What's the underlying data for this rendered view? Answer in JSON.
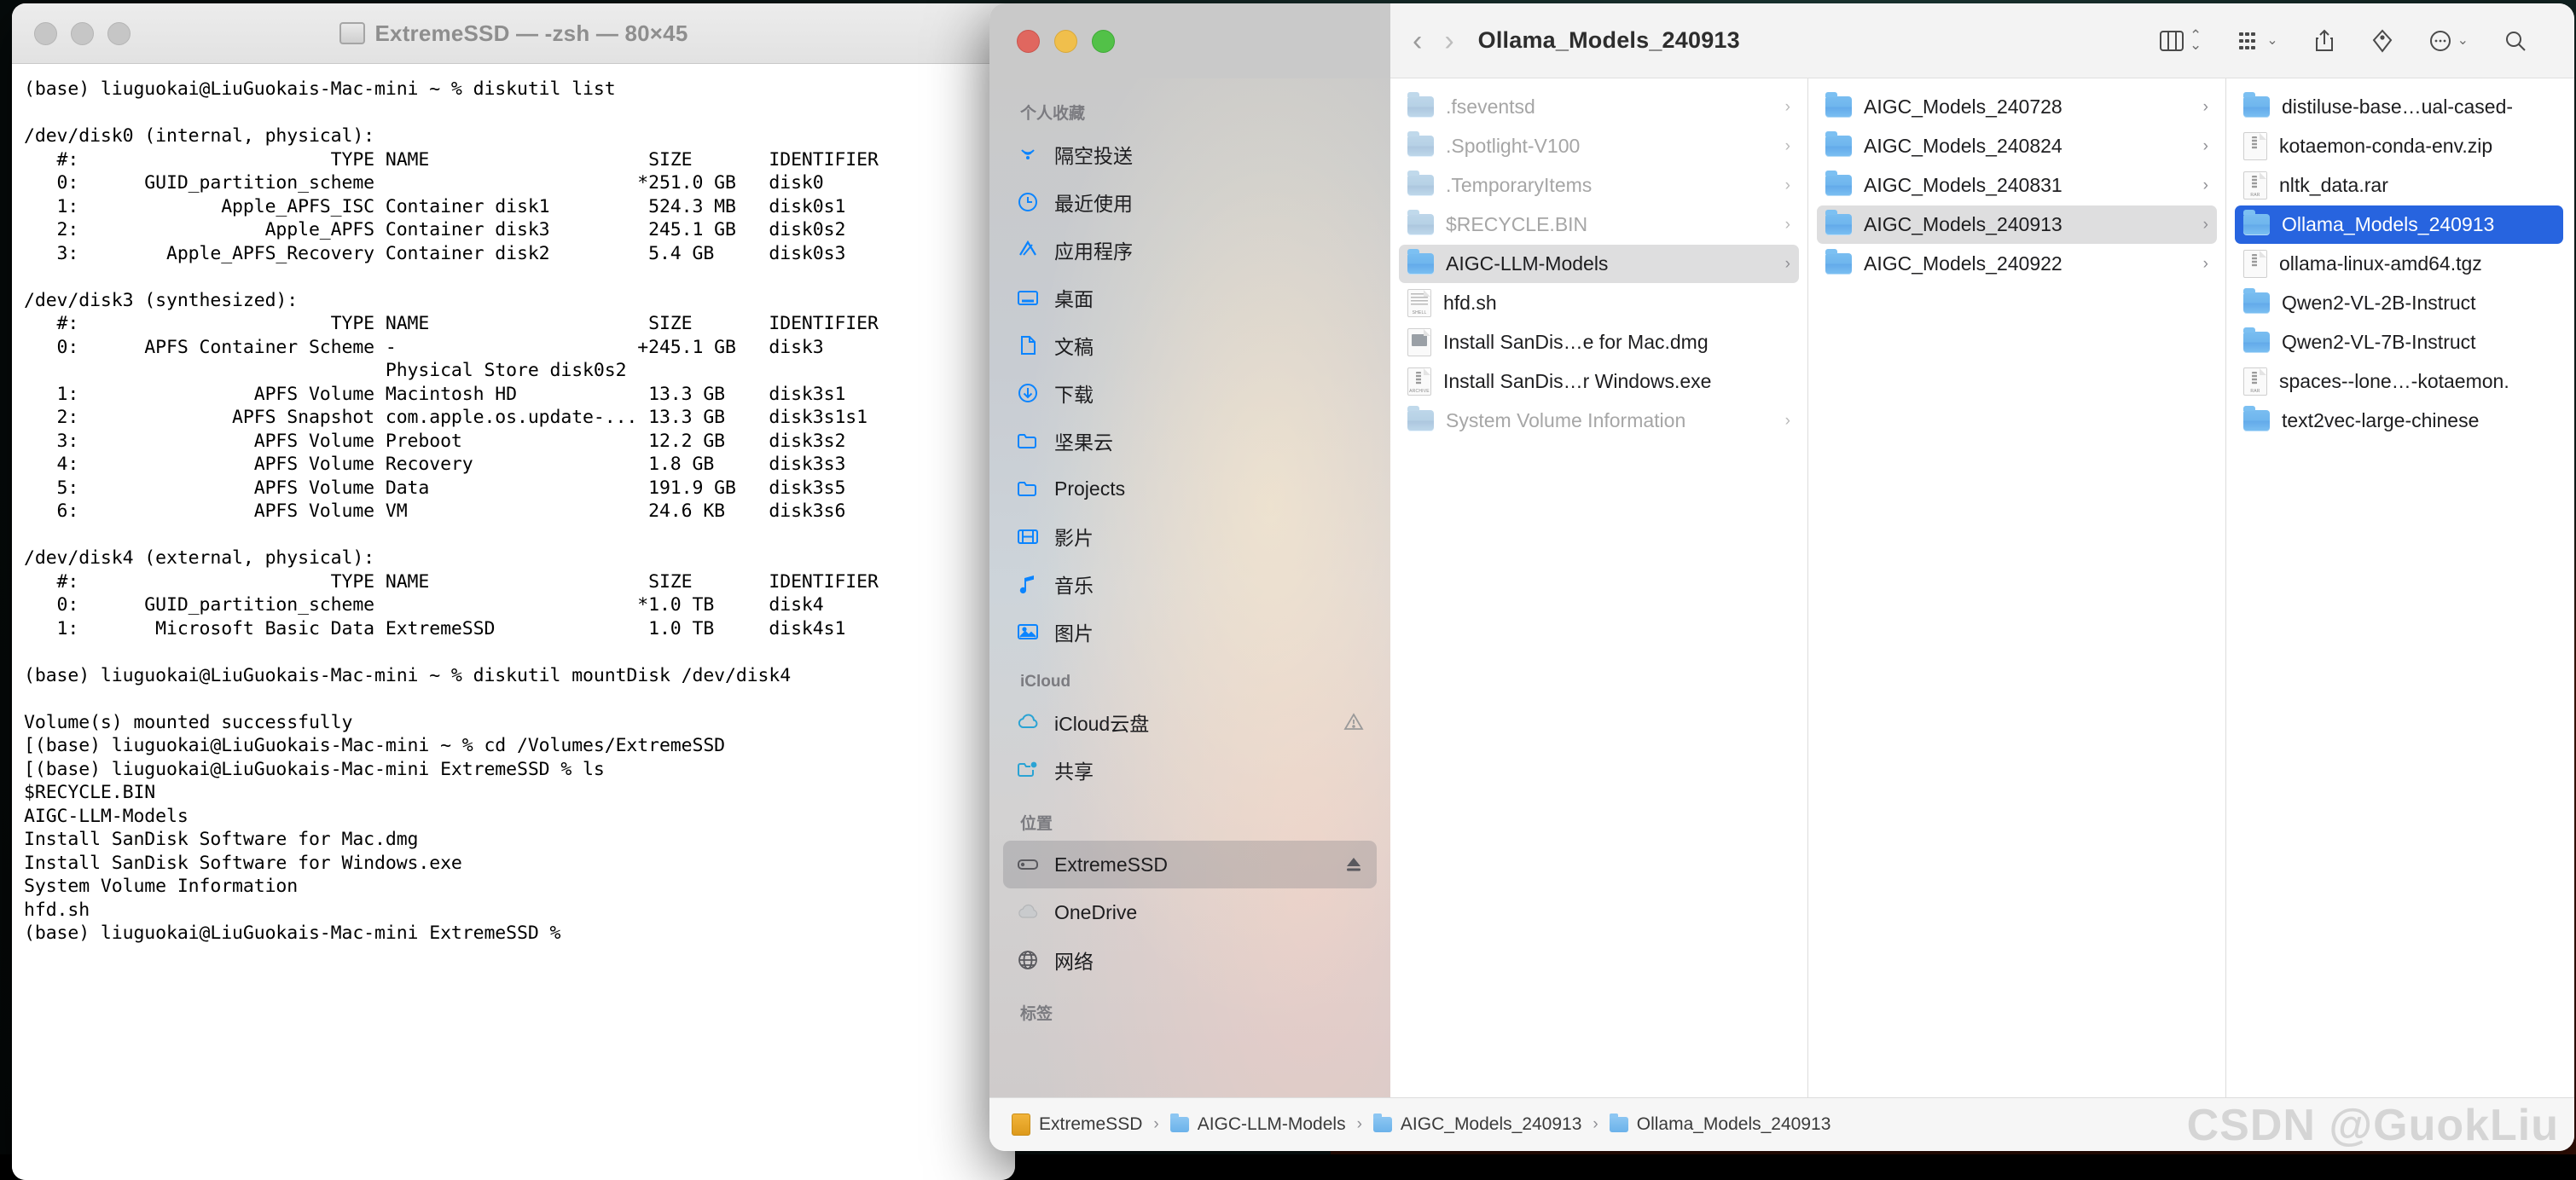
{
  "desktop": {
    "background_colors": [
      "#142826",
      "#2a1208"
    ]
  },
  "terminal": {
    "title": "ExtremeSSD — -zsh — 80×45",
    "title_icon": "disk-icon",
    "traffic_lights": [
      "close",
      "minimize",
      "zoom"
    ],
    "content": "(base) liuguokai@LiuGuokais-Mac-mini ~ % diskutil list\n\n/dev/disk0 (internal, physical):\n   #:                       TYPE NAME                    SIZE       IDENTIFIER\n   0:      GUID_partition_scheme                        *251.0 GB   disk0\n   1:             Apple_APFS_ISC Container disk1         524.3 MB   disk0s1\n   2:                 Apple_APFS Container disk3         245.1 GB   disk0s2\n   3:        Apple_APFS_Recovery Container disk2         5.4 GB     disk0s3\n\n/dev/disk3 (synthesized):\n   #:                       TYPE NAME                    SIZE       IDENTIFIER\n   0:      APFS Container Scheme -                      +245.1 GB   disk3\n                                 Physical Store disk0s2\n   1:                APFS Volume Macintosh HD            13.3 GB    disk3s1\n   2:              APFS Snapshot com.apple.os.update-... 13.3 GB    disk3s1s1\n   3:                APFS Volume Preboot                 12.2 GB    disk3s2\n   4:                APFS Volume Recovery                1.8 GB     disk3s3\n   5:                APFS Volume Data                    191.9 GB   disk3s5\n   6:                APFS Volume VM                      24.6 KB    disk3s6\n\n/dev/disk4 (external, physical):\n   #:                       TYPE NAME                    SIZE       IDENTIFIER\n   0:      GUID_partition_scheme                        *1.0 TB     disk4\n   1:       Microsoft Basic Data ExtremeSSD              1.0 TB     disk4s1\n\n(base) liuguokai@LiuGuokais-Mac-mini ~ % diskutil mountDisk /dev/disk4\n\nVolume(s) mounted successfully\n[(base) liuguokai@LiuGuokais-Mac-mini ~ % cd /Volumes/ExtremeSSD\n[(base) liuguokai@LiuGuokais-Mac-mini ExtremeSSD % ls\n$RECYCLE.BIN\nAIGC-LLM-Models\nInstall SanDisk Software for Mac.dmg\nInstall SanDisk Software for Windows.exe\nSystem Volume Information\nhfd.sh\n(base) liuguokai@LiuGuokais-Mac-mini ExtremeSSD % "
  },
  "finder": {
    "title": "Ollama_Models_240913",
    "traffic_lights": [
      "close",
      "minimize",
      "zoom"
    ],
    "toolbar": {
      "back_label": "‹",
      "forward_label": "›",
      "view_icon": "column-view-icon",
      "view_caret": "⌃⌄",
      "group_icon": "group-by-icon",
      "group_caret": "⌄",
      "share_icon": "share-icon",
      "tag_icon": "tag-icon",
      "more_icon": "more-actions-icon",
      "more_caret": "⌄",
      "search_icon": "search-icon"
    },
    "sidebar": {
      "sections": [
        {
          "title": "个人收藏",
          "items": [
            {
              "label": "隔空投送",
              "icon": "airdrop-icon",
              "selected": false
            },
            {
              "label": "最近使用",
              "icon": "recents-clock-icon",
              "selected": false
            },
            {
              "label": "应用程序",
              "icon": "applications-icon",
              "selected": false
            },
            {
              "label": "桌面",
              "icon": "desktop-icon",
              "selected": false
            },
            {
              "label": "文稿",
              "icon": "documents-icon",
              "selected": false
            },
            {
              "label": "下载",
              "icon": "downloads-icon",
              "selected": false
            },
            {
              "label": "坚果云",
              "icon": "folder-icon",
              "selected": false
            },
            {
              "label": "Projects",
              "icon": "folder-icon",
              "selected": false
            },
            {
              "label": "影片",
              "icon": "movies-icon",
              "selected": false
            },
            {
              "label": "音乐",
              "icon": "music-icon",
              "selected": false
            },
            {
              "label": "图片",
              "icon": "pictures-icon",
              "selected": false
            }
          ]
        },
        {
          "title": "iCloud",
          "items": [
            {
              "label": "iCloud云盘",
              "icon": "icloud-icon",
              "selected": false,
              "trail": "warning-icon"
            },
            {
              "label": "共享",
              "icon": "shared-folder-icon",
              "selected": false
            }
          ]
        },
        {
          "title": "位置",
          "items": [
            {
              "label": "ExtremeSSD",
              "icon": "external-drive-icon",
              "selected": true,
              "trail": "eject-icon"
            },
            {
              "label": "OneDrive",
              "icon": "onedrive-cloud-icon",
              "selected": false
            },
            {
              "label": "网络",
              "icon": "network-globe-icon",
              "selected": false
            }
          ]
        },
        {
          "title": "标签",
          "items": []
        }
      ]
    },
    "columns": [
      {
        "name": "column-extremessd",
        "items": [
          {
            "label": ".fseventsd",
            "icon": "folder-icon",
            "type": "folder",
            "state": "dim",
            "arrow": "›"
          },
          {
            "label": ".Spotlight-V100",
            "icon": "folder-icon",
            "type": "folder",
            "state": "dim",
            "arrow": "›"
          },
          {
            "label": ".TemporaryItems",
            "icon": "folder-icon",
            "type": "folder",
            "state": "dim",
            "arrow": "›"
          },
          {
            "label": "$RECYCLE.BIN",
            "icon": "folder-icon",
            "type": "folder",
            "state": "dim",
            "arrow": "›"
          },
          {
            "label": "AIGC-LLM-Models",
            "icon": "folder-icon",
            "type": "folder",
            "state": "highlighted",
            "arrow": "›"
          },
          {
            "label": "hfd.sh",
            "icon": "shell-script-icon",
            "type": "file-shell",
            "state": "normal",
            "arrow": ""
          },
          {
            "label": "Install SanDis…e for Mac.dmg",
            "icon": "disk-image-icon",
            "type": "file-dmg",
            "state": "normal",
            "arrow": ""
          },
          {
            "label": "Install SanDis…r Windows.exe",
            "icon": "archive-icon",
            "type": "file-archive",
            "state": "normal",
            "arrow": ""
          },
          {
            "label": "System Volume Information",
            "icon": "folder-icon",
            "type": "folder",
            "state": "dim",
            "arrow": "›"
          }
        ]
      },
      {
        "name": "column-aigc-llm-models",
        "items": [
          {
            "label": "AIGC_Models_240728",
            "icon": "folder-icon",
            "type": "folder",
            "state": "normal",
            "arrow": "›"
          },
          {
            "label": "AIGC_Models_240824",
            "icon": "folder-icon",
            "type": "folder",
            "state": "normal",
            "arrow": "›"
          },
          {
            "label": "AIGC_Models_240831",
            "icon": "folder-icon",
            "type": "folder",
            "state": "normal",
            "arrow": "›"
          },
          {
            "label": "AIGC_Models_240913",
            "icon": "folder-icon",
            "type": "folder",
            "state": "highlighted",
            "arrow": "›"
          },
          {
            "label": "AIGC_Models_240922",
            "icon": "folder-icon",
            "type": "folder",
            "state": "normal",
            "arrow": "›"
          }
        ]
      },
      {
        "name": "column-aigc-models-240913",
        "items": [
          {
            "label": "distiluse-base…ual-cased-",
            "icon": "folder-icon",
            "type": "folder",
            "state": "normal",
            "arrow": ""
          },
          {
            "label": "kotaemon-conda-env.zip",
            "icon": "archive-icon",
            "type": "file-archive",
            "state": "normal",
            "arrow": ""
          },
          {
            "label": "nltk_data.rar",
            "icon": "archive-icon",
            "type": "file-archive",
            "state": "normal",
            "arrow": ""
          },
          {
            "label": "Ollama_Models_240913",
            "icon": "folder-icon",
            "type": "folder",
            "state": "selected",
            "arrow": ""
          },
          {
            "label": "ollama-linux-amd64.tgz",
            "icon": "archive-icon",
            "type": "file-archive",
            "state": "normal",
            "arrow": ""
          },
          {
            "label": "Qwen2-VL-2B-Instruct",
            "icon": "folder-icon",
            "type": "folder",
            "state": "normal",
            "arrow": ""
          },
          {
            "label": "Qwen2-VL-7B-Instruct",
            "icon": "folder-icon",
            "type": "folder",
            "state": "normal",
            "arrow": ""
          },
          {
            "label": "spaces--lone…-kotaemon.",
            "icon": "archive-icon",
            "type": "file-archive",
            "state": "normal",
            "arrow": ""
          },
          {
            "label": "text2vec-large-chinese",
            "icon": "folder-icon",
            "type": "folder",
            "state": "normal",
            "arrow": ""
          }
        ]
      }
    ],
    "pathbar": {
      "crumbs": [
        {
          "label": "ExtremeSSD",
          "icon": "external-drive-icon"
        },
        {
          "label": "AIGC-LLM-Models",
          "icon": "folder-icon"
        },
        {
          "label": "AIGC_Models_240913",
          "icon": "folder-icon"
        },
        {
          "label": "Ollama_Models_240913",
          "icon": "folder-icon"
        }
      ],
      "separator": "›"
    }
  },
  "watermark": {
    "text": "CSDN @GuokLiu"
  },
  "colors": {
    "selection_blue": "#2764df",
    "highlight_grey": "#dededf",
    "sidebar_selected": "rgba(128,128,134,.32)"
  }
}
